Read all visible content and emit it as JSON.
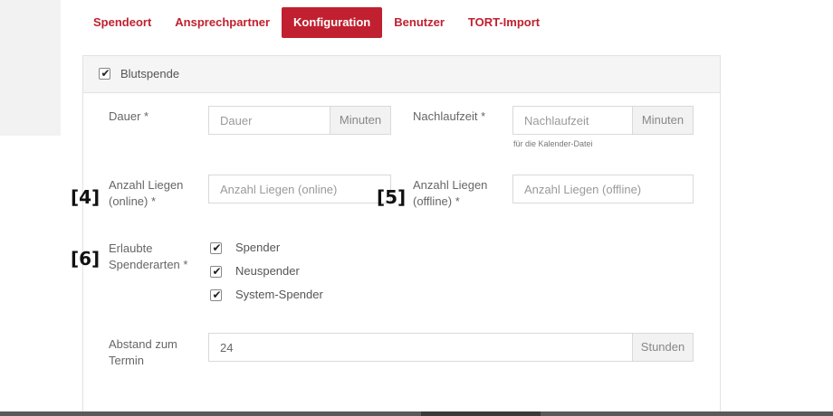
{
  "tabs": [
    {
      "label": "Spendeort"
    },
    {
      "label": "Ansprechpartner"
    },
    {
      "label": "Konfiguration",
      "active": true
    },
    {
      "label": "Benutzer"
    },
    {
      "label": "TORT-Import"
    }
  ],
  "panel": {
    "header_checkbox_label": "Blutspende",
    "header_checked": true
  },
  "fields": {
    "dauer": {
      "label": "Dauer *",
      "placeholder": "Dauer",
      "addon": "Minuten"
    },
    "nachlaufzeit": {
      "label": "Nachlaufzeit *",
      "placeholder": "Nachlaufzeit",
      "addon": "Minuten",
      "note": "für die Kalender-Datei"
    },
    "liegen_online": {
      "label_line1": "Anzahl Liegen",
      "label_line2": "(online) *",
      "placeholder": "Anzahl Liegen (online)"
    },
    "liegen_offline": {
      "label_line1": "Anzahl Liegen",
      "label_line2": "(offline) *",
      "placeholder": "Anzahl Liegen (offline)"
    },
    "spenderarten": {
      "label_line1": "Erlaubte",
      "label_line2": "Spenderarten *",
      "options": [
        {
          "label": "Spender",
          "checked": true
        },
        {
          "label": "Neuspender",
          "checked": true
        },
        {
          "label": "System-Spender",
          "checked": true
        }
      ]
    },
    "abstand": {
      "label_line1": "Abstand zum",
      "label_line2": "Termin",
      "value": "24",
      "addon": "Stunden"
    }
  },
  "markers": {
    "m4": "[4]",
    "m5": "[5]",
    "m6": "[6]"
  },
  "colors": {
    "accent": "#c0202f",
    "border": "#d9d9d9",
    "addon_bg": "#f2f2f2"
  }
}
